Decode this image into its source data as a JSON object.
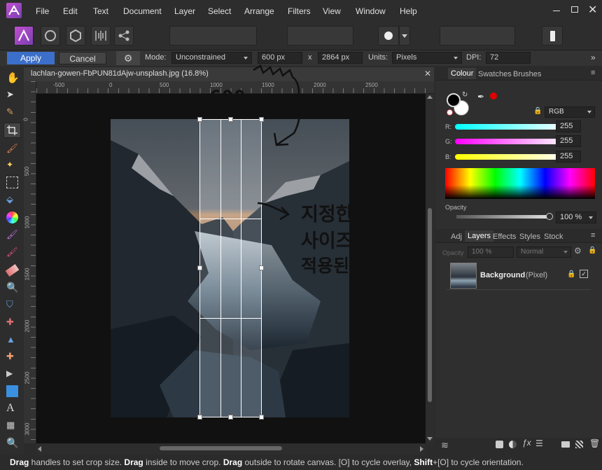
{
  "menu": {
    "items": [
      "File",
      "Edit",
      "Text",
      "Document",
      "Layer",
      "Select",
      "Arrange",
      "Filters",
      "View",
      "Window",
      "Help"
    ]
  },
  "context": {
    "apply": "Apply",
    "cancel": "Cancel",
    "mode_label": "Mode:",
    "mode_value": "Unconstrained",
    "width": "600 px",
    "x_sep": "x",
    "height": "2864 px",
    "units_label": "Units:",
    "units_value": "Pixels",
    "dpi_label": "DPI:",
    "dpi_value": "72"
  },
  "document": {
    "tab_title": "lachlan-gowen-FbPUN81dAjw-unsplash.jpg (16.8%)",
    "ruler_unit": "px",
    "ruler_top": [
      "-500",
      "0",
      "500",
      "1000",
      "1500",
      "2000",
      "2500"
    ],
    "ruler_left": [
      "0",
      "500",
      "1000",
      "1500",
      "2000",
      "2500",
      "3000"
    ]
  },
  "colour_panel": {
    "tabs": [
      "Colour",
      "Swatches",
      "Brushes"
    ],
    "model": "RGB",
    "r_label": "R:",
    "r_value": "255",
    "g_label": "G:",
    "g_value": "255",
    "b_label": "B:",
    "b_value": "255",
    "opacity_label": "Opacity",
    "opacity_value": "100 %"
  },
  "layers_panel": {
    "tabs": [
      "Adj",
      "Layers",
      "Effects",
      "Styles",
      "Stock"
    ],
    "opacity_label": "Opacity",
    "opacity_value": "100 %",
    "blend_mode": "Normal",
    "layer_name": "Background",
    "layer_type": "(Pixel)"
  },
  "annotations": {
    "size_note": "600",
    "caption_line1": "지정한",
    "caption_line2": "사이즈가",
    "caption_line3": "적용된 모습"
  },
  "status": {
    "b1": "Drag",
    "t1": " handles to set crop size. ",
    "b2": "Drag",
    "t2": " inside to move crop. ",
    "b3": "Drag",
    "t3": " outside to rotate canvas. [O] to cycle overlay, ",
    "b4": "Shift",
    "t4": "+[O] to cycle orientation."
  },
  "colors": {
    "accent": "#3b6fc9",
    "red_picker": "#e00000"
  }
}
